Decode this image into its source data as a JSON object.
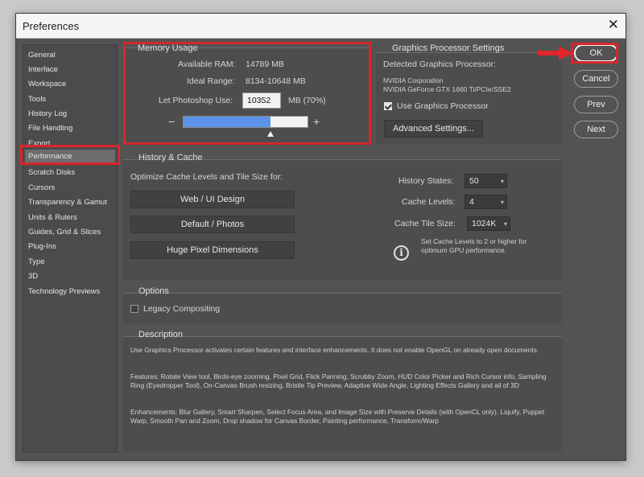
{
  "window": {
    "title": "Preferences",
    "close_glyph": "✕"
  },
  "sidebar": {
    "items": [
      {
        "label": "General"
      },
      {
        "label": "Interface"
      },
      {
        "label": "Workspace"
      },
      {
        "label": "Tools"
      },
      {
        "label": "History Log"
      },
      {
        "label": "File Handling"
      },
      {
        "label": "Export"
      },
      {
        "label": "Performance"
      },
      {
        "label": "Scratch Disks"
      },
      {
        "label": "Cursors"
      },
      {
        "label": "Transparency & Gamut"
      },
      {
        "label": "Units & Rulers"
      },
      {
        "label": "Guides, Grid & Slices"
      },
      {
        "label": "Plug-Ins"
      },
      {
        "label": "Type"
      },
      {
        "label": "3D"
      },
      {
        "label": "Technology Previews"
      }
    ],
    "selected": "Performance"
  },
  "memory": {
    "title": "Memory Usage",
    "available_label": "Available RAM:",
    "available_value": "14789 MB",
    "ideal_label": "Ideal Range:",
    "ideal_value": "8134-10648 MB",
    "use_label": "Let Photoshop Use:",
    "use_value": "10352",
    "use_suffix": "MB (70%)",
    "minus": "−",
    "plus": "+",
    "slider_fraction": 0.7
  },
  "gpu": {
    "title": "Graphics Processor Settings",
    "detected_label": "Detected Graphics Processor:",
    "vendor": "NVIDIA Corporation",
    "model": "NVIDIA GeForce GTX 1660 Ti/PCIe/SSE2",
    "use_gpu_label": "Use Graphics Processor",
    "use_gpu_checked": true,
    "advanced_button": "Advanced Settings..."
  },
  "history_cache": {
    "title": "History & Cache",
    "optimize_label": "Optimize Cache Levels and Tile Size for:",
    "btn_web": "Web / UI Design",
    "btn_default": "Default / Photos",
    "btn_huge": "Huge Pixel Dimensions",
    "history_states_label": "History States:",
    "history_states_value": "50",
    "cache_levels_label": "Cache Levels:",
    "cache_levels_value": "4",
    "tile_size_label": "Cache Tile Size:",
    "tile_size_value": "1024K",
    "info_line1": "Set Cache Levels to 2 or higher for",
    "info_line2": "optimum GPU performance.",
    "info_glyph": "i"
  },
  "options": {
    "title": "Options",
    "legacy_label": "Legacy Compositing",
    "legacy_checked": false
  },
  "description": {
    "title": "Description",
    "p1": "Use Graphics Processor activates certain features and interface enhancements. It does not enable OpenGL on already open documents.",
    "p2": "Features: Rotate View tool, Birds-eye zooming, Pixel Grid, Flick Panning, Scrubby Zoom, HUD Color Picker and Rich Cursor info, Sampling Ring (Eyedropper Tool), On-Canvas Brush resizing, Bristle Tip Preview, Adaptive Wide Angle, Lighting Effects Gallery and all of 3D",
    "p3": "Enhancements: Blur Gallery, Smart Sharpen, Select Focus Area, and Image Size with Preserve Details (with OpenCL only), Liquify, Puppet Warp, Smooth Pan and Zoom, Drop shadow for Canvas Border, Painting performance, Transform/Warp"
  },
  "buttons": {
    "ok": "OK",
    "cancel": "Cancel",
    "prev": "Prev",
    "next": "Next"
  },
  "colors": {
    "highlight_red": "#d6272b",
    "slider_fill": "#5b93e8",
    "arrow_red": "#e0262a"
  },
  "icons": {
    "ok_pointer": "red-arrow-icon",
    "slider_thumb": "triangle-thumb-icon",
    "info": "info-circle-icon"
  }
}
